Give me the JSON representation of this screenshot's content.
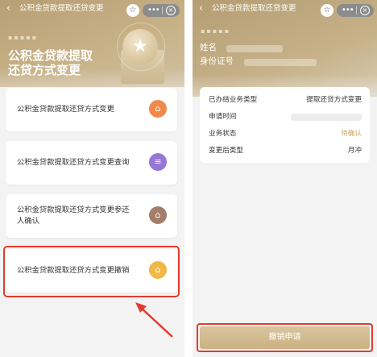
{
  "colors": {
    "accent": "#c9b185",
    "highlight_red": "#e53a2e",
    "pending": "#c9a56a",
    "icon_orange": "#f08a4b",
    "icon_purple": "#9577d6",
    "icon_brown": "#a27e6b",
    "icon_yellow": "#f1b844"
  },
  "left": {
    "topbar": {
      "back_icon": "chevron-left-icon",
      "back_glyph": "‹",
      "title": "公积金贷款提取还贷变更",
      "star_glyph": "☆",
      "more_glyph": "•••",
      "close_glyph": "×"
    },
    "hero": {
      "title_line1": "公积金贷款提取",
      "title_line2": "还贷方式变更",
      "dots": "▪▪▪▪▪",
      "coin_glyph": "★"
    },
    "services": [
      {
        "label_line1": "公积金贷款提取还贷方式变更",
        "label_line2": "",
        "icon": "house-icon",
        "glyph": "⌂"
      },
      {
        "label_line1": "公积金贷款提取还贷方式变更查询",
        "label_line2": "",
        "icon": "document-icon",
        "glyph": "≡"
      },
      {
        "label_line1": "公积金贷款提取还贷方式变更参还",
        "label_line2": "人确认",
        "icon": "home-check-icon",
        "glyph": "⌂"
      },
      {
        "label_line1": "公积金贷款提取还贷方式变更撤销",
        "label_line2": "",
        "icon": "house-cancel-icon",
        "glyph": "⌂"
      }
    ]
  },
  "right": {
    "topbar": {
      "back_glyph": "‹",
      "title": "公积金贷款提取还贷变更",
      "star_glyph": "☆",
      "more_glyph": "•••",
      "close_glyph": "×"
    },
    "profile": {
      "dots": "▪▪▪▪▪",
      "name_label": "姓名",
      "id_label": "身份证号"
    },
    "info_rows": [
      {
        "key": "已办结业务类型",
        "value": "提取还贷方式变更"
      },
      {
        "key": "申请时间",
        "value": ""
      },
      {
        "key": "业务状态",
        "value": "待确认"
      },
      {
        "key": "变更后类型",
        "value": "月冲"
      }
    ],
    "bottom_button": "撤销申请"
  }
}
